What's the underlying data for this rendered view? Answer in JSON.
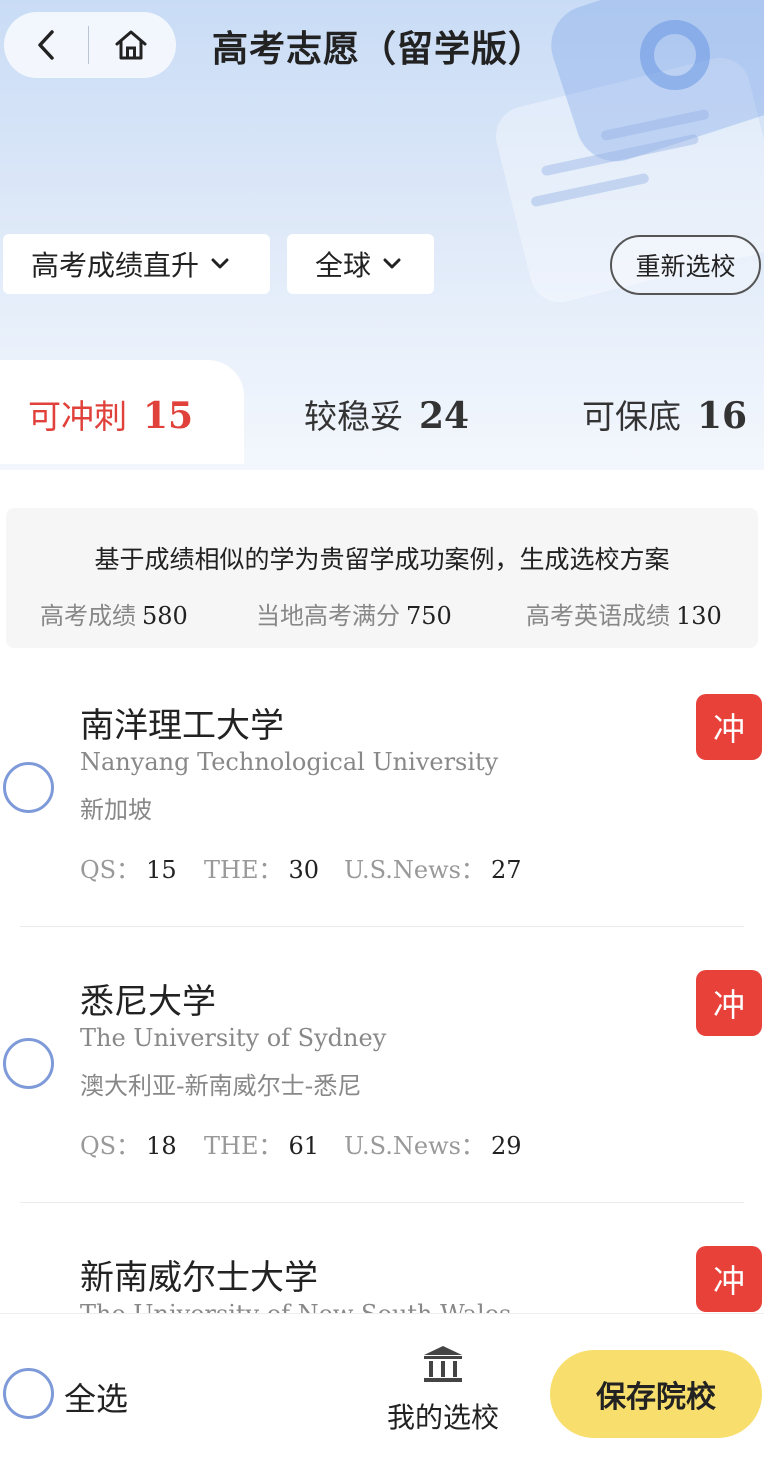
{
  "header": {
    "title": "高考志愿（留学版）",
    "back_icon": "back-arrow-icon",
    "home_icon": "home-icon"
  },
  "filters": {
    "mode_label": "高考成绩直升",
    "region_label": "全球",
    "reselect_label": "重新选校"
  },
  "tabs": [
    {
      "label": "可冲刺",
      "count": "15",
      "active": true
    },
    {
      "label": "较稳妥",
      "count": "24",
      "active": false
    },
    {
      "label": "可保底",
      "count": "16",
      "active": false
    }
  ],
  "info": {
    "title": "基于成绩相似的学为贵留学成功案例，生成选校方案",
    "stats": [
      {
        "label": "高考成绩",
        "value": "580"
      },
      {
        "label": "当地高考满分",
        "value": "750"
      },
      {
        "label": "高考英语成绩",
        "value": "130"
      }
    ]
  },
  "universities": [
    {
      "name": "南洋理工大学",
      "name_en": "Nanyang Technological University",
      "location": "新加坡",
      "ranks": [
        {
          "label": "QS：",
          "value": "15"
        },
        {
          "label": "THE：",
          "value": "30"
        },
        {
          "label": "U.S.News：",
          "value": "27"
        }
      ],
      "badge": "冲"
    },
    {
      "name": "悉尼大学",
      "name_en": "The University of Sydney",
      "location": "澳大利亚-新南威尔士-悉尼",
      "ranks": [
        {
          "label": "QS：",
          "value": "18"
        },
        {
          "label": "THE：",
          "value": "61"
        },
        {
          "label": "U.S.News：",
          "value": "29"
        }
      ],
      "badge": "冲"
    },
    {
      "name": "新南威尔士大学",
      "name_en": "The University of New South Wales",
      "location": "",
      "ranks": [],
      "badge": "冲"
    }
  ],
  "bottom": {
    "select_all_label": "全选",
    "my_choice_label": "我的选校",
    "my_choice_icon": "institution-icon",
    "save_label": "保存院校"
  },
  "colors": {
    "accent_red": "#e8413a",
    "radio_blue": "#7e9ad8",
    "save_yellow": "#f7de6d"
  }
}
